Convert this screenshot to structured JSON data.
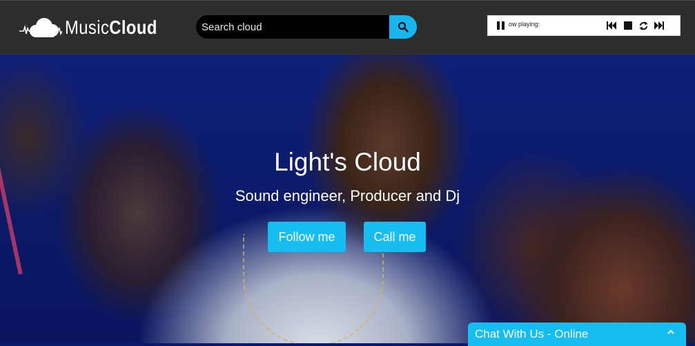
{
  "header": {
    "brand_light": "Music",
    "brand_bold": "Cloud",
    "search": {
      "placeholder": "Search cloud"
    },
    "player": {
      "now_playing": "ow playing:",
      "controls": [
        "pause-icon",
        "previous-icon",
        "stop-icon",
        "repeat-icon",
        "next-icon"
      ]
    }
  },
  "hero": {
    "title": "Light's Cloud",
    "subtitle": "Sound engineer, Producer and Dj",
    "buttons": {
      "follow": "Follow me",
      "call": "Call me"
    }
  },
  "chat": {
    "label": "Chat With Us - Online"
  },
  "colors": {
    "accent": "#15bdf0",
    "navbar": "#2d2d2d",
    "search_bg": "#000000"
  }
}
